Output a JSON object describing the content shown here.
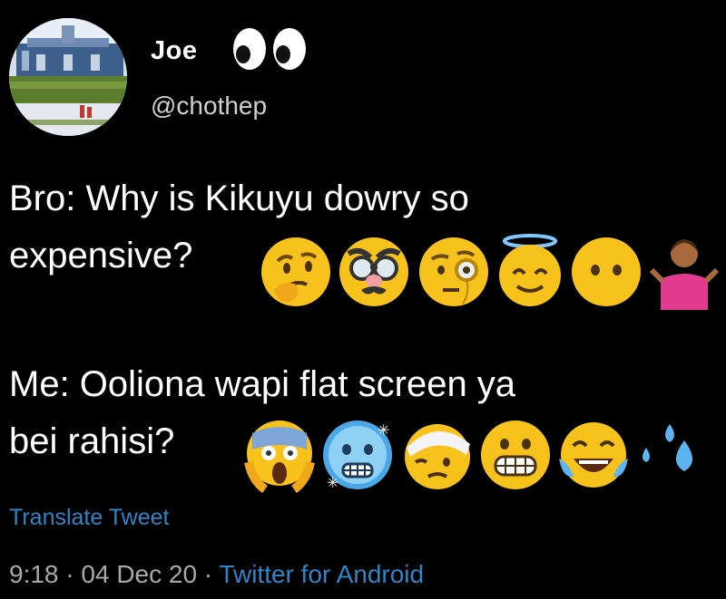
{
  "tweet": {
    "name": "Joe",
    "name_emoji": "eyes-emoji",
    "handle": "@chothep",
    "lines": [
      "Bro: Why is Kikuyu dowry so",
      "expensive?",
      "Me: Ooliona wapi flat screen ya",
      "bei rahisi?"
    ],
    "emoji_row_1": [
      "thinking-face",
      "disguised-face",
      "face-with-monocle",
      "smiling-face-with-halo",
      "face-without-mouth",
      "person-shrugging"
    ],
    "emoji_row_2": [
      "face-screaming-in-fear",
      "cold-face",
      "face-with-head-bandage",
      "grimacing-face",
      "face-with-tears-of-joy",
      "sweat-droplets"
    ],
    "translate_label": "Translate Tweet",
    "time": "9:18",
    "date": "04 Dec 20",
    "separator": " · ",
    "source": "Twitter for Android"
  },
  "colors": {
    "background": "#000000",
    "link": "#2e86c9",
    "muted": "#a8a8a8"
  }
}
